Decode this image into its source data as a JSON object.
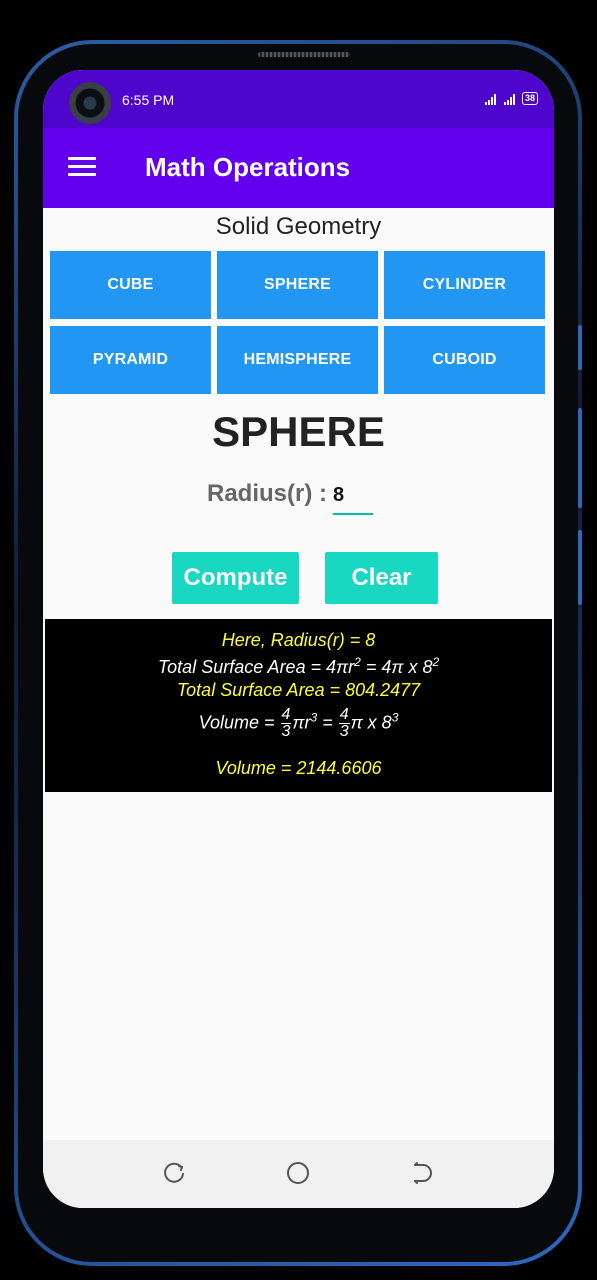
{
  "status_bar": {
    "time": "6:55 PM",
    "battery": "38"
  },
  "app_bar": {
    "title": "Math Operations",
    "menu_icon": "hamburger-menu-icon"
  },
  "section_title": "Solid Geometry",
  "shape_buttons": [
    "CUBE",
    "SPHERE",
    "CYLINDER",
    "PYRAMID",
    "HEMISPHERE",
    "CUBOID"
  ],
  "shape_heading": "SPHERE",
  "radius": {
    "label": "Radius(r) :",
    "value": "8"
  },
  "actions": {
    "compute": "Compute",
    "clear": "Clear"
  },
  "result": {
    "given": "Here, Radius(r) = 8",
    "tsa_formula_prefix": "Total Surface Area = 4πr",
    "tsa_formula_exp1": "2",
    "tsa_formula_mid": " = 4π x 8",
    "tsa_formula_exp2": "2",
    "tsa_value": "Total Surface Area = 804.2477",
    "volume_prefix": "Volume =",
    "frac_num": "4",
    "frac_den": "3",
    "volume_pi_r": "πr",
    "volume_exp1": "3",
    "volume_eq": "=",
    "volume_pi_x": "π x 8",
    "volume_exp2": "3",
    "volume_value": "Volume = 2144.6606"
  },
  "nav_bar": {
    "icons": [
      "recent-apps-icon",
      "home-icon",
      "back-icon"
    ]
  },
  "colors": {
    "status_bar": "#4e06cc",
    "app_bar": "#6200ee",
    "shape_button": "#2196f3",
    "action_button": "#18d8c2",
    "result_bg": "#000000",
    "result_highlight": "#ffff33"
  }
}
